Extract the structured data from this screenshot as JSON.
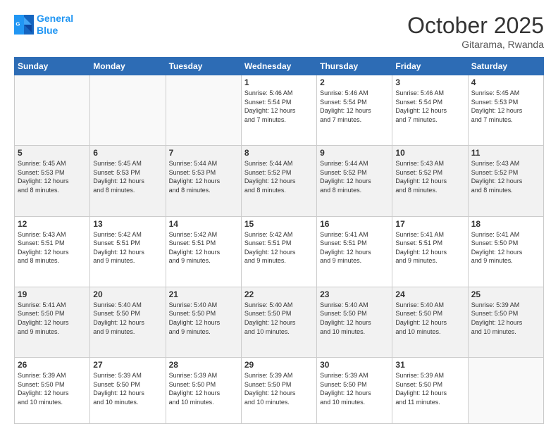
{
  "header": {
    "logo_line1": "General",
    "logo_line2": "Blue",
    "month": "October 2025",
    "location": "Gitarama, Rwanda"
  },
  "weekdays": [
    "Sunday",
    "Monday",
    "Tuesday",
    "Wednesday",
    "Thursday",
    "Friday",
    "Saturday"
  ],
  "weeks": [
    [
      {
        "day": "",
        "info": ""
      },
      {
        "day": "",
        "info": ""
      },
      {
        "day": "",
        "info": ""
      },
      {
        "day": "1",
        "info": "Sunrise: 5:46 AM\nSunset: 5:54 PM\nDaylight: 12 hours\nand 7 minutes."
      },
      {
        "day": "2",
        "info": "Sunrise: 5:46 AM\nSunset: 5:54 PM\nDaylight: 12 hours\nand 7 minutes."
      },
      {
        "day": "3",
        "info": "Sunrise: 5:46 AM\nSunset: 5:54 PM\nDaylight: 12 hours\nand 7 minutes."
      },
      {
        "day": "4",
        "info": "Sunrise: 5:45 AM\nSunset: 5:53 PM\nDaylight: 12 hours\nand 7 minutes."
      }
    ],
    [
      {
        "day": "5",
        "info": "Sunrise: 5:45 AM\nSunset: 5:53 PM\nDaylight: 12 hours\nand 8 minutes."
      },
      {
        "day": "6",
        "info": "Sunrise: 5:45 AM\nSunset: 5:53 PM\nDaylight: 12 hours\nand 8 minutes."
      },
      {
        "day": "7",
        "info": "Sunrise: 5:44 AM\nSunset: 5:53 PM\nDaylight: 12 hours\nand 8 minutes."
      },
      {
        "day": "8",
        "info": "Sunrise: 5:44 AM\nSunset: 5:52 PM\nDaylight: 12 hours\nand 8 minutes."
      },
      {
        "day": "9",
        "info": "Sunrise: 5:44 AM\nSunset: 5:52 PM\nDaylight: 12 hours\nand 8 minutes."
      },
      {
        "day": "10",
        "info": "Sunrise: 5:43 AM\nSunset: 5:52 PM\nDaylight: 12 hours\nand 8 minutes."
      },
      {
        "day": "11",
        "info": "Sunrise: 5:43 AM\nSunset: 5:52 PM\nDaylight: 12 hours\nand 8 minutes."
      }
    ],
    [
      {
        "day": "12",
        "info": "Sunrise: 5:43 AM\nSunset: 5:51 PM\nDaylight: 12 hours\nand 8 minutes."
      },
      {
        "day": "13",
        "info": "Sunrise: 5:42 AM\nSunset: 5:51 PM\nDaylight: 12 hours\nand 9 minutes."
      },
      {
        "day": "14",
        "info": "Sunrise: 5:42 AM\nSunset: 5:51 PM\nDaylight: 12 hours\nand 9 minutes."
      },
      {
        "day": "15",
        "info": "Sunrise: 5:42 AM\nSunset: 5:51 PM\nDaylight: 12 hours\nand 9 minutes."
      },
      {
        "day": "16",
        "info": "Sunrise: 5:41 AM\nSunset: 5:51 PM\nDaylight: 12 hours\nand 9 minutes."
      },
      {
        "day": "17",
        "info": "Sunrise: 5:41 AM\nSunset: 5:51 PM\nDaylight: 12 hours\nand 9 minutes."
      },
      {
        "day": "18",
        "info": "Sunrise: 5:41 AM\nSunset: 5:50 PM\nDaylight: 12 hours\nand 9 minutes."
      }
    ],
    [
      {
        "day": "19",
        "info": "Sunrise: 5:41 AM\nSunset: 5:50 PM\nDaylight: 12 hours\nand 9 minutes."
      },
      {
        "day": "20",
        "info": "Sunrise: 5:40 AM\nSunset: 5:50 PM\nDaylight: 12 hours\nand 9 minutes."
      },
      {
        "day": "21",
        "info": "Sunrise: 5:40 AM\nSunset: 5:50 PM\nDaylight: 12 hours\nand 9 minutes."
      },
      {
        "day": "22",
        "info": "Sunrise: 5:40 AM\nSunset: 5:50 PM\nDaylight: 12 hours\nand 10 minutes."
      },
      {
        "day": "23",
        "info": "Sunrise: 5:40 AM\nSunset: 5:50 PM\nDaylight: 12 hours\nand 10 minutes."
      },
      {
        "day": "24",
        "info": "Sunrise: 5:40 AM\nSunset: 5:50 PM\nDaylight: 12 hours\nand 10 minutes."
      },
      {
        "day": "25",
        "info": "Sunrise: 5:39 AM\nSunset: 5:50 PM\nDaylight: 12 hours\nand 10 minutes."
      }
    ],
    [
      {
        "day": "26",
        "info": "Sunrise: 5:39 AM\nSunset: 5:50 PM\nDaylight: 12 hours\nand 10 minutes."
      },
      {
        "day": "27",
        "info": "Sunrise: 5:39 AM\nSunset: 5:50 PM\nDaylight: 12 hours\nand 10 minutes."
      },
      {
        "day": "28",
        "info": "Sunrise: 5:39 AM\nSunset: 5:50 PM\nDaylight: 12 hours\nand 10 minutes."
      },
      {
        "day": "29",
        "info": "Sunrise: 5:39 AM\nSunset: 5:50 PM\nDaylight: 12 hours\nand 10 minutes."
      },
      {
        "day": "30",
        "info": "Sunrise: 5:39 AM\nSunset: 5:50 PM\nDaylight: 12 hours\nand 10 minutes."
      },
      {
        "day": "31",
        "info": "Sunrise: 5:39 AM\nSunset: 5:50 PM\nDaylight: 12 hours\nand 11 minutes."
      },
      {
        "day": "",
        "info": ""
      }
    ]
  ]
}
